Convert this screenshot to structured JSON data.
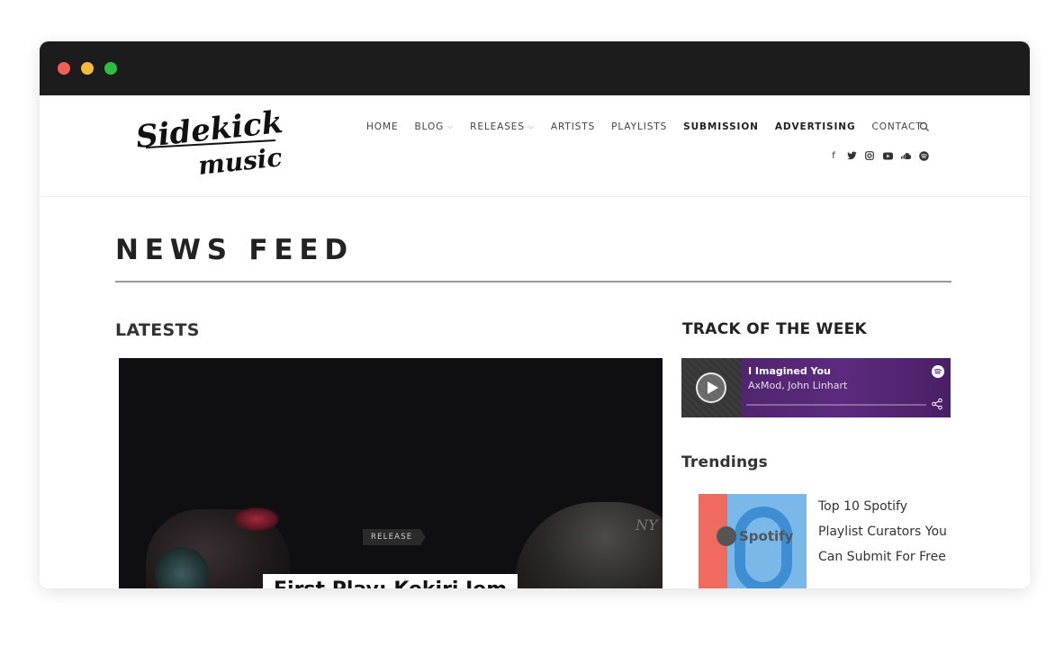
{
  "window": {
    "controls": [
      "close",
      "minimize",
      "maximize"
    ]
  },
  "brand": {
    "logo_line1": "Sidekick",
    "logo_line2": "music"
  },
  "nav": {
    "home": "HOME",
    "blog": "BLOG",
    "releases": "RELEASES",
    "artists": "ARTISTS",
    "playlists": "PLAYLISTS",
    "submission": "SUBMISSION",
    "advertising": "ADVERTISING",
    "contact": "CONTACT"
  },
  "social_icons": [
    "facebook-icon",
    "twitter-icon",
    "instagram-icon",
    "youtube-icon",
    "soundcloud-icon",
    "spotify-icon"
  ],
  "page": {
    "title": "NEWS FEED",
    "latests": "LATESTS"
  },
  "hero": {
    "tag": "RELEASE",
    "title": "First Play: Kekiri Jem"
  },
  "sidebar": {
    "track_heading": "TRACK OF THE WEEK",
    "track_title": "I Imagined You",
    "track_artist": "AxMod, John Linhart",
    "trendings_heading": "Trendings",
    "trend_thumb_label": "Spotify",
    "trend_item_text": "Top 10 Spotify Playlist Curators You Can Submit For Free"
  },
  "colors": {
    "player_bg": "#5c2a7e",
    "titlebar": "#1c1c1c"
  }
}
